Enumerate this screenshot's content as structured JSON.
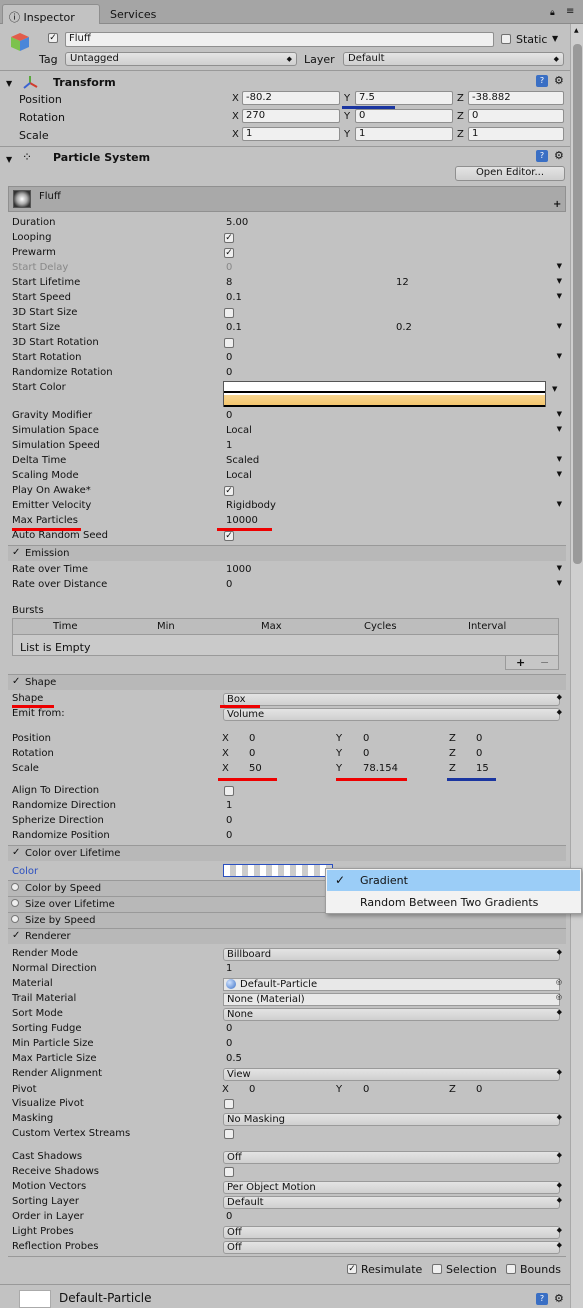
{
  "tabs": {
    "inspector": "Inspector",
    "services": "Services"
  },
  "object": {
    "name": "Fluff",
    "static_label": "Static",
    "tag_label": "Tag",
    "tag_value": "Untagged",
    "layer_label": "Layer",
    "layer_value": "Default"
  },
  "transform": {
    "title": "Transform",
    "position_label": "Position",
    "rotation_label": "Rotation",
    "scale_label": "Scale",
    "x": "X",
    "y": "Y",
    "z": "Z",
    "position": [
      "-80.2",
      "7.5",
      "-38.882"
    ],
    "rotation": [
      "270",
      "0",
      "0"
    ],
    "scale": [
      "1",
      "1",
      "1"
    ]
  },
  "particle_system": {
    "title": "Particle System",
    "open_editor": "Open Editor...",
    "system_name": "Fluff",
    "main": [
      {
        "label": "Duration",
        "value": "5.00"
      },
      {
        "label": "Looping",
        "check": true
      },
      {
        "label": "Prewarm",
        "check": true
      },
      {
        "label": "Start Delay",
        "value": "0",
        "disabled": true
      },
      {
        "label": "Start Lifetime",
        "value": "8",
        "value2": "12"
      },
      {
        "label": "Start Speed",
        "value": "0.1"
      },
      {
        "label": "3D Start Size",
        "check": false
      },
      {
        "label": "Start Size",
        "value": "0.1",
        "value2": "0.2"
      },
      {
        "label": "3D Start Rotation",
        "check": false
      },
      {
        "label": "Start Rotation",
        "value": "0"
      },
      {
        "label": "Randomize Rotation",
        "value": "0"
      },
      {
        "label": "Start Color"
      }
    ],
    "main2": [
      {
        "label": "Gravity Modifier",
        "value": "0"
      },
      {
        "label": "Simulation Space",
        "value": "Local"
      },
      {
        "label": "Simulation Speed",
        "value": "1"
      },
      {
        "label": "Delta Time",
        "value": "Scaled"
      },
      {
        "label": "Scaling Mode",
        "value": "Local"
      },
      {
        "label": "Play On Awake*",
        "check": true
      },
      {
        "label": "Emitter Velocity",
        "value": "Rigidbody"
      },
      {
        "label": "Max Particles",
        "value": "10000"
      },
      {
        "label": "Auto Random Seed",
        "check": true
      }
    ],
    "emission": {
      "title": "Emission",
      "rate_time_label": "Rate over Time",
      "rate_time": "1000",
      "rate_distance_label": "Rate over Distance",
      "rate_distance": "0",
      "bursts_label": "Bursts",
      "columns": [
        "Time",
        "Min",
        "Max",
        "Cycles",
        "Interval"
      ],
      "empty": "List is Empty",
      "plus": "+",
      "minus": "−"
    },
    "shape": {
      "title": "Shape",
      "shape_label": "Shape",
      "shape_value": "Box",
      "emit_label": "Emit from:",
      "emit_value": "Volume",
      "position_label": "Position",
      "rotation_label": "Rotation",
      "scale_label": "Scale",
      "position": [
        "0",
        "0",
        "0"
      ],
      "rotation": [
        "0",
        "0",
        "0"
      ],
      "scale": [
        "50",
        "78.154",
        "15"
      ],
      "align_label": "Align To Direction",
      "randdir_label": "Randomize Direction",
      "randdir": "1",
      "spherize_label": "Spherize Direction",
      "spherize": "0",
      "randpos_label": "Randomize Position",
      "randpos": "0"
    },
    "col": {
      "title": "Color over Lifetime",
      "color_label": "Color"
    },
    "col_speed": "Color by Speed",
    "size_life": "Size over Lifetime",
    "size_speed": "Size by Speed",
    "renderer": {
      "title": "Renderer",
      "rows": [
        {
          "label": "Render Mode",
          "value": "Billboard",
          "dd": true
        },
        {
          "label": "Normal Direction",
          "value": "1"
        },
        {
          "label": "Material",
          "value": "Default-Particle",
          "obj": true
        },
        {
          "label": "Trail Material",
          "value": "None (Material)",
          "obj": true
        },
        {
          "label": "Sort Mode",
          "value": "None",
          "dd": true
        },
        {
          "label": "Sorting Fudge",
          "value": "0"
        },
        {
          "label": "Min Particle Size",
          "value": "0"
        },
        {
          "label": "Max Particle Size",
          "value": "0.5"
        },
        {
          "label": "Render Alignment",
          "value": "View",
          "dd": true
        }
      ],
      "pivot_label": "Pivot",
      "pivot": [
        "0",
        "0",
        "0"
      ],
      "vispivot_label": "Visualize Pivot",
      "masking_label": "Masking",
      "masking": "No Masking",
      "cvs_label": "Custom Vertex Streams",
      "rows2": [
        {
          "label": "Cast Shadows",
          "value": "Off",
          "dd": true
        },
        {
          "label": "Receive Shadows",
          "check": false
        },
        {
          "label": "Motion Vectors",
          "value": "Per Object Motion",
          "dd": true
        },
        {
          "label": "Sorting Layer",
          "value": "Default",
          "dd": true
        },
        {
          "label": "Order in Layer",
          "value": "0"
        },
        {
          "label": "Light Probes",
          "value": "Off",
          "dd": true
        },
        {
          "label": "Reflection Probes",
          "value": "Off",
          "dd": true
        }
      ]
    },
    "footer": {
      "resimulate": "Resimulate",
      "selection": "Selection",
      "bounds": "Bounds"
    }
  },
  "material_footer": "Default-Particle",
  "popup": {
    "items": [
      "Gradient",
      "Random Between Two Gradients"
    ],
    "selected_mark": "✓"
  },
  "colors": {
    "red_marker": "#e00000",
    "blue_marker": "#1a35a0",
    "popup_selected": "#9bcdf7"
  }
}
